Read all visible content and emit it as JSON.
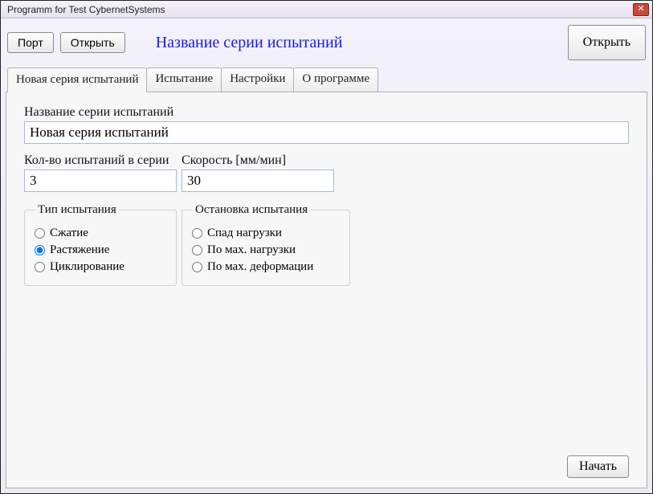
{
  "window": {
    "title": "Programm for Test CybernetSystems"
  },
  "toolbar": {
    "port_label": "Порт",
    "open1_label": "Открыть",
    "series_heading": "Название серии испытаний",
    "open2_label": "Открыть"
  },
  "tabs": {
    "new_series": "Новая серия испытаний",
    "test": "Испытание",
    "settings": "Настройки",
    "about": "О программе"
  },
  "form": {
    "series_name_label": "Название серии испытаний",
    "series_name_value": "Новая серия испытаний",
    "count_label": "Кол-во испытаний в серии",
    "count_value": "3",
    "speed_label": "Скорость [мм/мин]",
    "speed_value": "30"
  },
  "test_type": {
    "legend": "Тип испытания",
    "options": {
      "compress": "Сжатие",
      "tension": "Растяжение",
      "cycle": "Циклирование"
    },
    "selected": "tension"
  },
  "stop_cond": {
    "legend": "Остановка испытания",
    "options": {
      "load_drop": "Спад нагрузки",
      "max_load": "По мах. нагрузки",
      "max_def": "По мах. деформации"
    },
    "selected": ""
  },
  "actions": {
    "start_label": "Начать"
  }
}
